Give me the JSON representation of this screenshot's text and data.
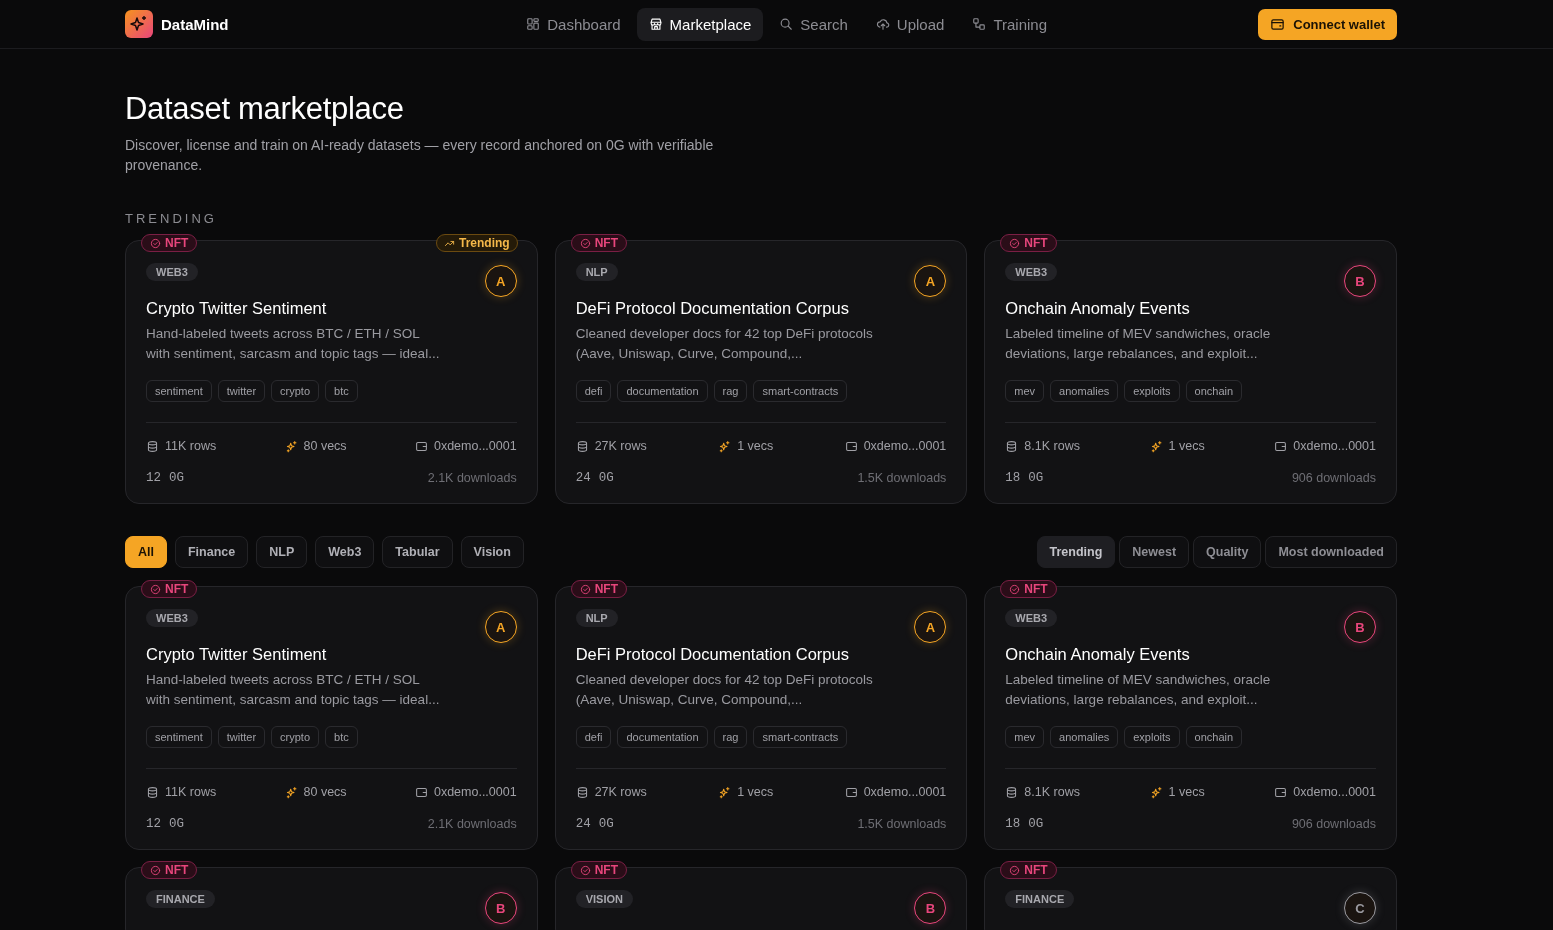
{
  "brand": {
    "name": "DataMind"
  },
  "nav": [
    {
      "label": "Dashboard",
      "selected": false
    },
    {
      "label": "Marketplace",
      "selected": true
    },
    {
      "label": "Search",
      "selected": false
    },
    {
      "label": "Upload",
      "selected": false
    },
    {
      "label": "Training",
      "selected": false
    }
  ],
  "connect_button": "Connect wallet",
  "page": {
    "title": "Dataset marketplace",
    "subtitle": "Discover, license and train on AI-ready datasets — every record anchored on 0G with verifiable provenance."
  },
  "trending": {
    "heading": "TRENDING",
    "cards": [
      {
        "badge": "NFT",
        "trending": "Trending",
        "category": "WEB3",
        "grade": {
          "label": "A",
          "color": "#f5a524"
        },
        "title": "Crypto Twitter Sentiment",
        "description": "Hand-labeled tweets across BTC / ETH / SOL with sentiment, sarcasm and topic tags — ideal...",
        "tags": [
          "sentiment",
          "twitter",
          "crypto",
          "btc"
        ],
        "rows": "11K rows",
        "vecs": "80 vecs",
        "owner": "0xdemo...0001",
        "price": "12",
        "currency": "0G",
        "downloads": "2.1K downloads"
      },
      {
        "badge": "NFT",
        "category": "NLP",
        "grade": {
          "label": "A",
          "color": "#f5a524"
        },
        "title": "DeFi Protocol Documentation Corpus",
        "description": "Cleaned developer docs for 42 top DeFi protocols (Aave, Uniswap, Curve, Compound,...",
        "tags": [
          "defi",
          "documentation",
          "rag",
          "smart-contracts"
        ],
        "rows": "27K rows",
        "vecs": "1 vecs",
        "owner": "0xdemo...0001",
        "price": "24",
        "currency": "0G",
        "downloads": "1.5K downloads"
      },
      {
        "badge": "NFT",
        "category": "WEB3",
        "grade": {
          "label": "B",
          "color": "#e8467c"
        },
        "title": "Onchain Anomaly Events",
        "description": "Labeled timeline of MEV sandwiches, oracle deviations, large rebalances, and exploit...",
        "tags": [
          "mev",
          "anomalies",
          "exploits",
          "onchain"
        ],
        "rows": "8.1K rows",
        "vecs": "1 vecs",
        "owner": "0xdemo...0001",
        "price": "18",
        "currency": "0G",
        "downloads": "906 downloads"
      }
    ]
  },
  "filters": [
    {
      "label": "All",
      "selected": true
    },
    {
      "label": "Finance",
      "selected": false
    },
    {
      "label": "NLP",
      "selected": false
    },
    {
      "label": "Web3",
      "selected": false
    },
    {
      "label": "Tabular",
      "selected": false
    },
    {
      "label": "Vision",
      "selected": false
    }
  ],
  "sort": [
    {
      "label": "Trending",
      "selected": true
    },
    {
      "label": "Newest",
      "selected": false
    },
    {
      "label": "Quality",
      "selected": false
    },
    {
      "label": "Most downloaded",
      "selected": false
    }
  ],
  "datasets": [
    {
      "badge": "NFT",
      "category": "WEB3",
      "grade": {
        "label": "A",
        "color": "#f5a524"
      },
      "title": "Crypto Twitter Sentiment",
      "description": "Hand-labeled tweets across BTC / ETH / SOL with sentiment, sarcasm and topic tags — ideal...",
      "tags": [
        "sentiment",
        "twitter",
        "crypto",
        "btc"
      ],
      "rows": "11K rows",
      "vecs": "80 vecs",
      "owner": "0xdemo...0001",
      "price": "12",
      "currency": "0G",
      "downloads": "2.1K downloads"
    },
    {
      "badge": "NFT",
      "category": "NLP",
      "grade": {
        "label": "A",
        "color": "#f5a524"
      },
      "title": "DeFi Protocol Documentation Corpus",
      "description": "Cleaned developer docs for 42 top DeFi protocols (Aave, Uniswap, Curve, Compound,...",
      "tags": [
        "defi",
        "documentation",
        "rag",
        "smart-contracts"
      ],
      "rows": "27K rows",
      "vecs": "1 vecs",
      "owner": "0xdemo...0001",
      "price": "24",
      "currency": "0G",
      "downloads": "1.5K downloads"
    },
    {
      "badge": "NFT",
      "category": "WEB3",
      "grade": {
        "label": "B",
        "color": "#e8467c"
      },
      "title": "Onchain Anomaly Events",
      "description": "Labeled timeline of MEV sandwiches, oracle deviations, large rebalances, and exploit...",
      "tags": [
        "mev",
        "anomalies",
        "exploits",
        "onchain"
      ],
      "rows": "8.1K rows",
      "vecs": "1 vecs",
      "owner": "0xdemo...0001",
      "price": "18",
      "currency": "0G",
      "downloads": "906 downloads"
    },
    {
      "badge": "NFT",
      "category": "FINANCE",
      "grade": {
        "label": "B",
        "color": "#e8467c"
      }
    },
    {
      "badge": "NFT",
      "category": "VISION",
      "grade": {
        "label": "B",
        "color": "#e8467c"
      }
    },
    {
      "badge": "NFT",
      "category": "FINANCE",
      "grade": {
        "label": "C",
        "color": "#9a9aa0"
      }
    }
  ]
}
